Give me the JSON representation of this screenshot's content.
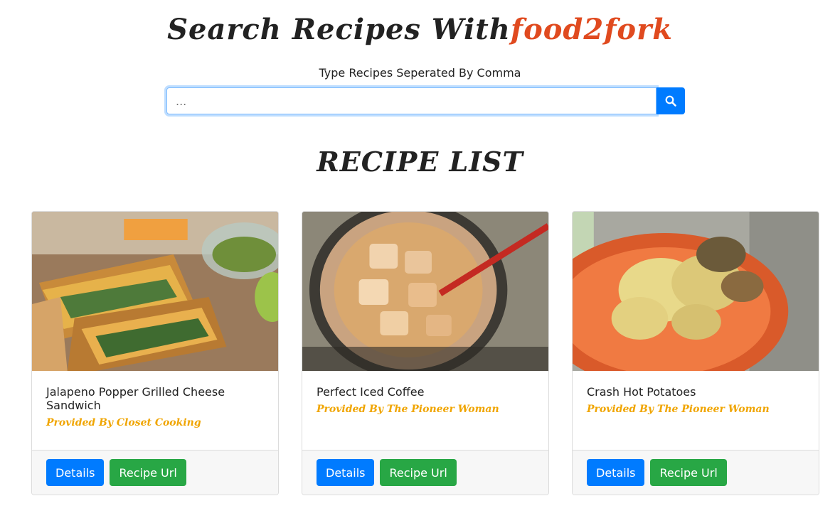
{
  "header": {
    "title_prefix": "Search Recipes With",
    "title_brand": "food2fork"
  },
  "search": {
    "label": "Type Recipes Seperated By Comma",
    "placeholder": "...",
    "value": "",
    "button_icon": "search-icon"
  },
  "list": {
    "heading": "RECIPE LIST"
  },
  "recipes": [
    {
      "title": "Jalapeno Popper Grilled Cheese Sandwich",
      "provider": "Provided By Closet Cooking",
      "image": "grilled-cheese-sandwich-photo",
      "details_label": "Details",
      "url_label": "Recipe Url"
    },
    {
      "title": "Perfect Iced Coffee",
      "provider": "Provided By The Pioneer Woman",
      "image": "iced-coffee-jar-photo",
      "details_label": "Details",
      "url_label": "Recipe Url"
    },
    {
      "title": "Crash Hot Potatoes",
      "provider": "Provided By The Pioneer Woman",
      "image": "crash-hot-potatoes-plate-photo",
      "details_label": "Details",
      "url_label": "Recipe Url"
    }
  ],
  "colors": {
    "brand": "#e04a1f",
    "provider": "#f0a500",
    "primary": "#007bff",
    "success": "#28a745"
  }
}
